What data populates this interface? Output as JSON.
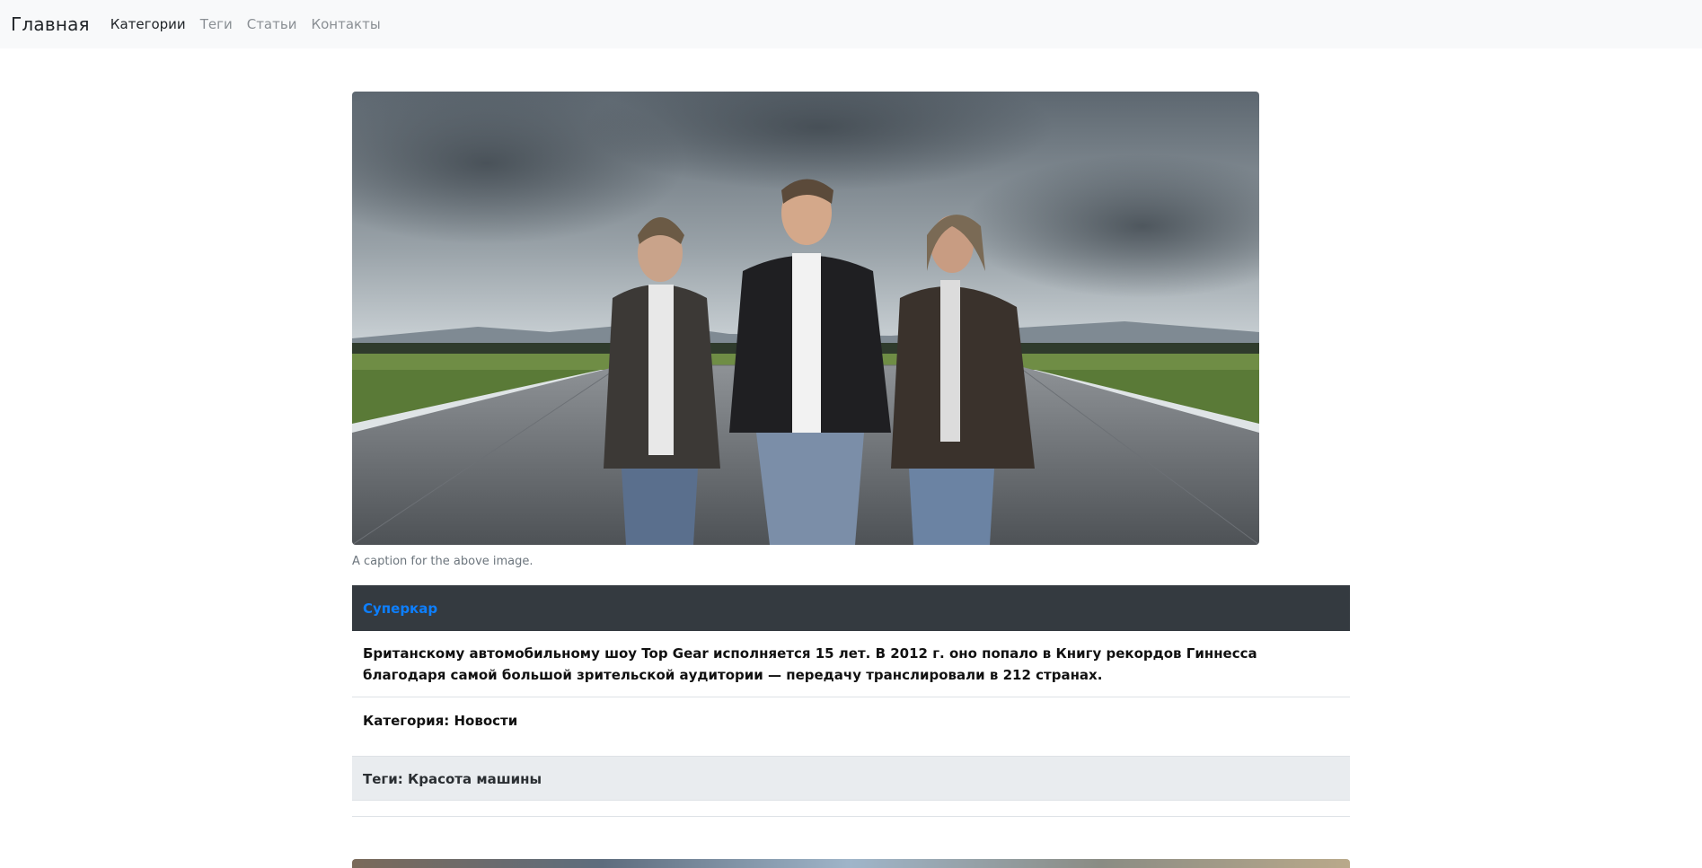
{
  "navbar": {
    "brand": "Главная",
    "links": [
      {
        "label": "Категории",
        "active": true
      },
      {
        "label": "Теги",
        "active": false
      },
      {
        "label": "Статьи",
        "active": false
      },
      {
        "label": "Контакты",
        "active": false
      }
    ]
  },
  "article": {
    "caption": "A caption for the above image.",
    "title": "Суперкар",
    "description": "Британскому автомобильному шоу Top Gear исполняется 15 лет. В 2012 г. оно попало в Книгу рекордов Гиннесса благодаря самой большой зрительской аудитории — передачу транслировали в 212 странах.",
    "category": "Категория: Новости",
    "tags": "Теги: Красота машины"
  },
  "colors": {
    "navbar_bg": "#f8f9fa",
    "card_header_bg": "#343a40",
    "title_link": "#0d7fff",
    "tags_bg": "#e9ecef"
  }
}
